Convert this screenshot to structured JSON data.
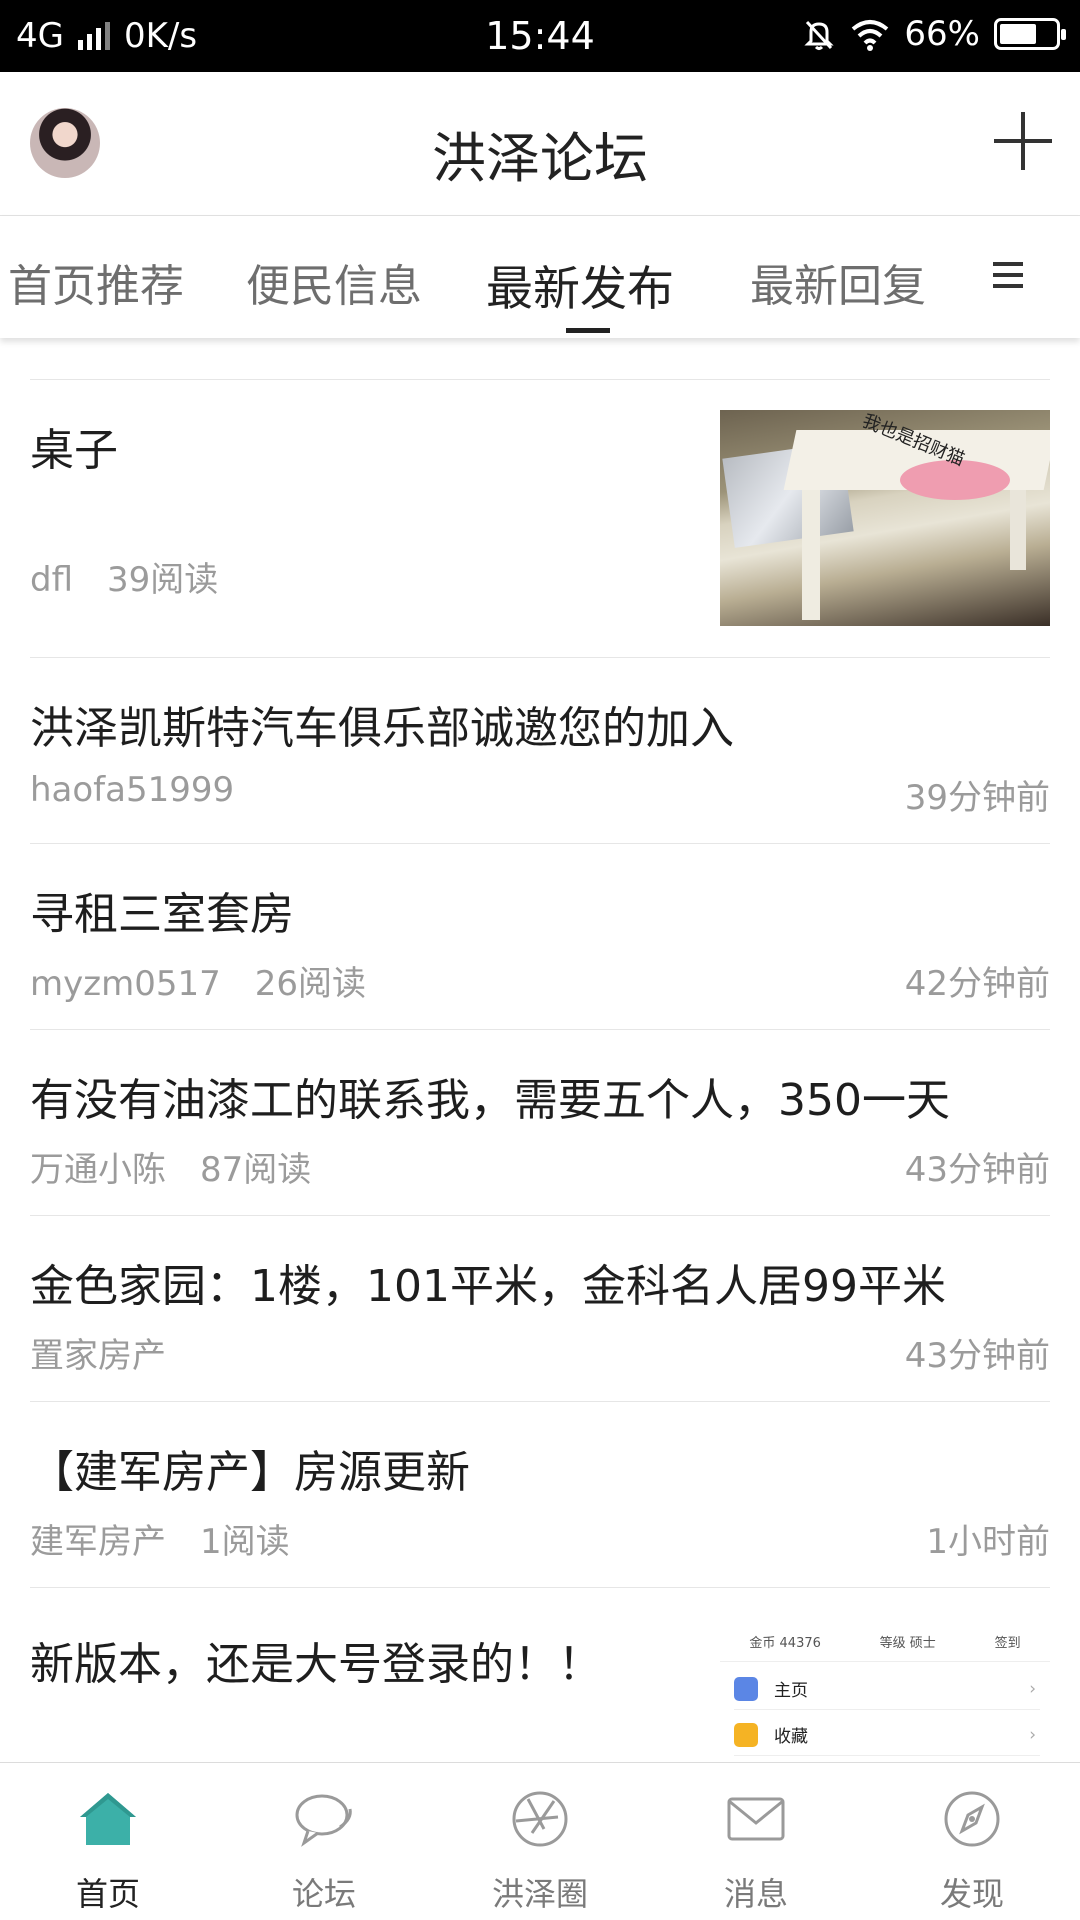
{
  "status_bar": {
    "network": "4G",
    "speed": "0K/s",
    "time": "15:44",
    "battery": "66%",
    "battery_level": 0.66
  },
  "header": {
    "title": "洪泽论坛"
  },
  "tabs": [
    {
      "label": "首页推荐",
      "active": false
    },
    {
      "label": "便民信息",
      "active": false
    },
    {
      "label": "最新发布",
      "active": true
    },
    {
      "label": "最新回复",
      "active": false
    }
  ],
  "posts": [
    {
      "title": "桌子",
      "author": "dfl",
      "reads": "39阅读",
      "time": ""
    },
    {
      "title": "洪泽凯斯特汽车俱乐部诚邀您的加入",
      "author": "haofa51999",
      "reads": "",
      "time": "39分钟前"
    },
    {
      "title": "寻租三室套房",
      "author": "myzm0517",
      "reads": "26阅读",
      "time": "42分钟前"
    },
    {
      "title": "有没有油漆工的联系我，需要五个人，350一天",
      "author": "万通小陈",
      "reads": "87阅读",
      "time": "43分钟前"
    },
    {
      "title": "金色家园：1楼，101平米，金科名人居99平米",
      "author": "置家房产",
      "reads": "",
      "time": "43分钟前"
    },
    {
      "title": "【建军房产】房源更新",
      "author": "建军房产",
      "reads": "1阅读",
      "time": "1小时前"
    },
    {
      "title": "新版本，还是大号登录的！！",
      "author": "",
      "reads": "",
      "time": ""
    }
  ],
  "thumb_photo": {
    "caption": "我也是招财猫"
  },
  "thumb_screen": {
    "coins": "金币 44376",
    "level": "等级  硕士",
    "checkin": "签到",
    "menu": [
      {
        "label": "主页",
        "color": "#5b86e5"
      },
      {
        "label": "收藏",
        "color": "#f5b324"
      },
      {
        "label": "",
        "color": "#3cc1b8"
      }
    ]
  },
  "bottom_nav": [
    {
      "label": "首页",
      "icon": "home-icon",
      "active": true
    },
    {
      "label": "论坛",
      "icon": "chat-bubble-icon",
      "active": false
    },
    {
      "label": "洪泽圈",
      "icon": "aperture-icon",
      "active": false
    },
    {
      "label": "消息",
      "icon": "envelope-icon",
      "active": false
    },
    {
      "label": "发现",
      "icon": "compass-icon",
      "active": false
    }
  ],
  "colors": {
    "accent": "#3cb0a8",
    "text": "#222222",
    "meta": "#9b9b9b"
  }
}
